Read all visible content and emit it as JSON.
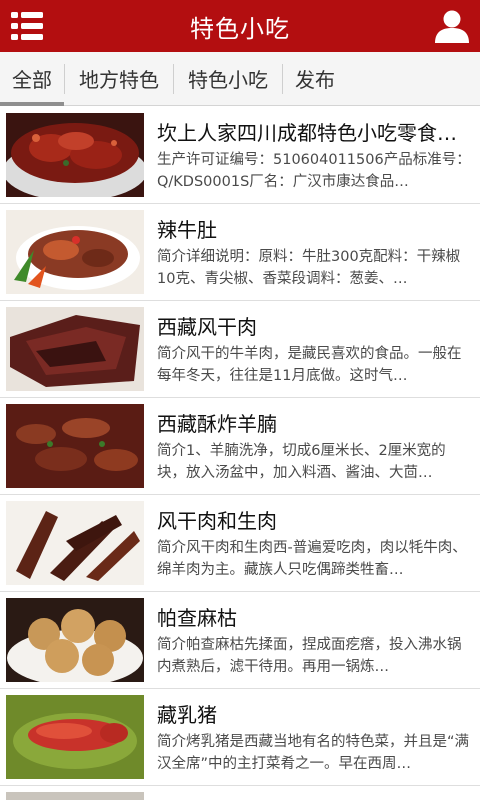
{
  "header": {
    "title": "特色小吃",
    "menu_icon": "list-menu-icon",
    "user_icon": "user-profile-icon",
    "bg_color": "#b30e10"
  },
  "tabs": [
    {
      "label": "全部",
      "active": true
    },
    {
      "label": "地方特色",
      "active": false
    },
    {
      "label": "特色小吃",
      "active": false
    },
    {
      "label": "发布",
      "active": false
    }
  ],
  "items": [
    {
      "title": "坎上人家四川成都特色小吃零食…",
      "desc": "生产许可证编号：510604011506产品标准号：Q/KDS0001S厂名：广汉市康达食品…"
    },
    {
      "title": "辣牛肚",
      "desc": "简介详细说明：原料：牛肚300克配料：干辣椒10克、青尖椒、香菜段调料：葱姜、…"
    },
    {
      "title": "西藏风干肉",
      "desc": "简介风干的牛羊肉，是藏民喜欢的食品。一般在每年冬天，往往是11月底做。这时气…"
    },
    {
      "title": "西藏酥炸羊腩",
      "desc": "简介1、羊腩洗净，切成6厘米长、2厘米宽的块，放入汤盆中，加入料酒、酱油、大茴…"
    },
    {
      "title": "风干肉和生肉",
      "desc": "简介风干肉和生肉西-普遍爱吃肉，肉以牦牛肉、绵羊肉为主。藏族人只吃偶蹄类牲畜…"
    },
    {
      "title": "帕查麻枯",
      "desc": "简介帕查麻枯先揉面，捏成面疙瘩，投入沸水锅内煮熟后，滤干待用。再用一锅炼…"
    },
    {
      "title": "藏乳猪",
      "desc": "简介烤乳猪是西藏当地有名的特色菜，并且是“满汉全席”中的主打菜肴之一。早在西周…"
    }
  ]
}
